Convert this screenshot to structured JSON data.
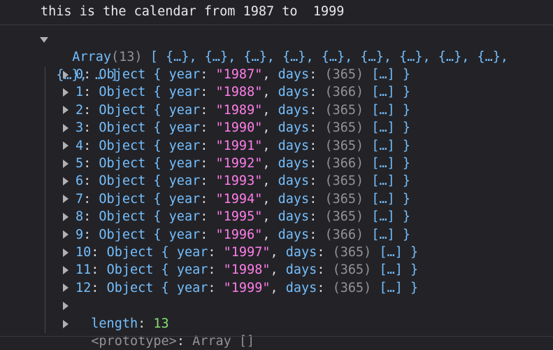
{
  "console": {
    "log_message": "this is the calendar from 1987 to  1999",
    "array": {
      "label": "Array",
      "count": "(13)",
      "preview_line1": "[ {…}, {…}, {…}, {…}, {…}, {…}, {…}, {…}, {…},",
      "preview_line2": "{…}, … ]",
      "items": [
        {
          "index": "0",
          "type": "Object",
          "year": "\"1987\"",
          "days": "(365)"
        },
        {
          "index": "1",
          "type": "Object",
          "year": "\"1988\"",
          "days": "(366)"
        },
        {
          "index": "2",
          "type": "Object",
          "year": "\"1989\"",
          "days": "(365)"
        },
        {
          "index": "3",
          "type": "Object",
          "year": "\"1990\"",
          "days": "(365)"
        },
        {
          "index": "4",
          "type": "Object",
          "year": "\"1991\"",
          "days": "(365)"
        },
        {
          "index": "5",
          "type": "Object",
          "year": "\"1992\"",
          "days": "(366)"
        },
        {
          "index": "6",
          "type": "Object",
          "year": "\"1993\"",
          "days": "(365)"
        },
        {
          "index": "7",
          "type": "Object",
          "year": "\"1994\"",
          "days": "(365)"
        },
        {
          "index": "8",
          "type": "Object",
          "year": "\"1995\"",
          "days": "(365)"
        },
        {
          "index": "9",
          "type": "Object",
          "year": "\"1996\"",
          "days": "(366)"
        },
        {
          "index": "10",
          "type": "Object",
          "year": "\"1997\"",
          "days": "(365)"
        },
        {
          "index": "11",
          "type": "Object",
          "year": "\"1998\"",
          "days": "(365)"
        },
        {
          "index": "12",
          "type": "Object",
          "year": "\"1999\"",
          "days": "(365)"
        }
      ],
      "year_key": "year",
      "days_key": "days",
      "collapsed_array": "[…]",
      "length_key": "length",
      "length_value": "13",
      "prototype_key": "<prototype>",
      "prototype_value": "Array []"
    }
  },
  "colors": {
    "background": "#232327",
    "key": "#75bfff",
    "string": "#ff7de9",
    "number": "#86de74",
    "muted": "#939395"
  }
}
